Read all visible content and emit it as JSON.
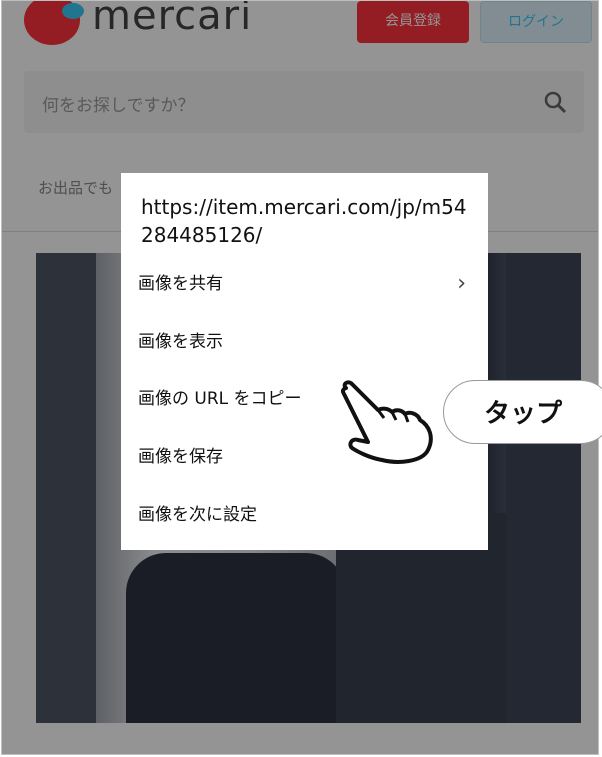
{
  "background_page": {
    "brand": "mercari",
    "signup_label": "会員登録",
    "login_label": "ログイン",
    "search_placeholder": "何をお探しですか？",
    "breadcrumb": "お出品でも"
  },
  "context_menu": {
    "url": "https://item.mercari.com/jp/m54284485126/",
    "items": [
      {
        "label": "画像を共有",
        "has_submenu": true
      },
      {
        "label": "画像を表示"
      },
      {
        "label": "画像の URL をコピー"
      },
      {
        "label": "画像を保存"
      },
      {
        "label": "画像を次に設定"
      }
    ]
  },
  "callout": {
    "label": "タップ"
  },
  "colors": {
    "brand_red": "#ff333f",
    "brand_blue": "#3ccaf5",
    "overlay": "rgba(0,0,0,0.42)"
  },
  "icons": [
    "search-icon",
    "chevron-right-icon",
    "pointing-hand-icon"
  ]
}
